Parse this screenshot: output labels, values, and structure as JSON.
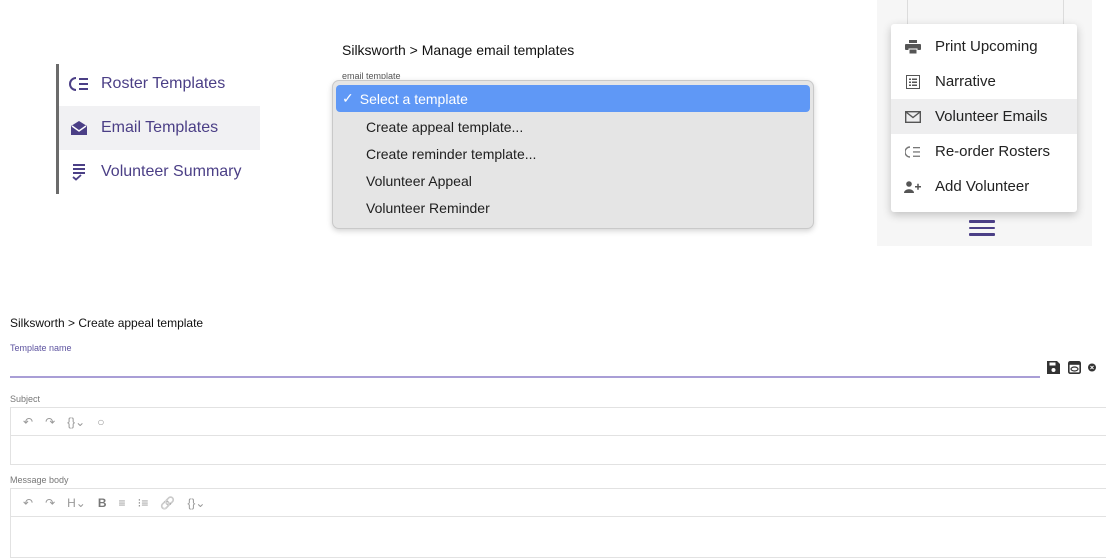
{
  "sidebar": {
    "items": [
      {
        "label": "Roster Templates",
        "icon": "reorder-icon"
      },
      {
        "label": "Email Templates",
        "icon": "open-envelope-icon"
      },
      {
        "label": "Volunteer Summary",
        "icon": "checklist-icon"
      }
    ]
  },
  "selector": {
    "breadcrumb": "Silksworth > Manage email templates",
    "label": "email template",
    "options": [
      "Select a template",
      "Create appeal template...",
      "Create reminder template...",
      "Volunteer Appeal",
      "Volunteer Reminder"
    ],
    "checkmark": "✓"
  },
  "menu": {
    "items": [
      {
        "label": "Print Upcoming",
        "icon": "printer-icon"
      },
      {
        "label": "Narrative",
        "icon": "list-box-icon"
      },
      {
        "label": "Volunteer Emails",
        "icon": "mail-icon"
      },
      {
        "label": "Re-order Rosters",
        "icon": "reorder-icon"
      },
      {
        "label": "Add Volunteer",
        "icon": "person-add-icon"
      }
    ]
  },
  "editor": {
    "breadcrumb": "Silksworth > Create appeal template",
    "template_name_label": "Template name",
    "subject_label": "Subject",
    "body_label": "Message body",
    "subject_toolbar": [
      "↶",
      "↷",
      "{}⌄",
      "○"
    ],
    "body_toolbar": [
      "↶",
      "↷",
      "H⌄",
      "B",
      "≡",
      "⁝≡",
      "🔗",
      "{}⌄"
    ]
  },
  "colors": {
    "accent": "#4b3f86",
    "selected_option": "#5f98f6",
    "underline": "#a99ed6"
  }
}
